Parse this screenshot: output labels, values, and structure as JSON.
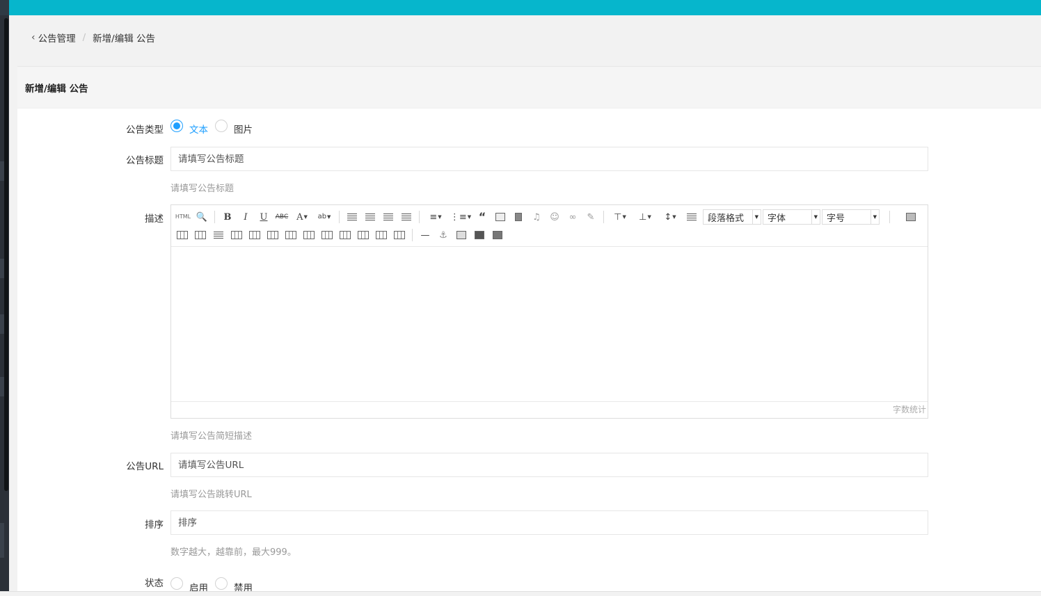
{
  "breadcrumb": {
    "back_icon": "‹",
    "parent": "公告管理",
    "separator": "/",
    "current": "新增/编辑 公告"
  },
  "card": {
    "title": "新增/编辑 公告"
  },
  "form": {
    "type": {
      "label": "公告类型",
      "options": [
        "文本",
        "图片"
      ],
      "selected": "文本"
    },
    "title": {
      "label": "公告标题",
      "placeholder": "请填写公告标题",
      "help": "请填写公告标题"
    },
    "desc": {
      "label": "描述",
      "help": "请填写公告简短描述",
      "word_count": "字数统计"
    },
    "url": {
      "label": "公告URL",
      "placeholder": "请填写公告URL",
      "help": "请填写公告跳转URL"
    },
    "sort": {
      "label": "排序",
      "placeholder": "排序",
      "help": "数字越大，越靠前，最大999。"
    },
    "status": {
      "label": "状态",
      "options": [
        "启用",
        "禁用"
      ]
    }
  },
  "editor": {
    "html_label": "HTML",
    "paragraph_combo": "段落格式",
    "font_combo": "字体",
    "size_combo": "字号"
  },
  "colors": {
    "accent": "#1e9fff",
    "topbar": "#06b6cc"
  }
}
